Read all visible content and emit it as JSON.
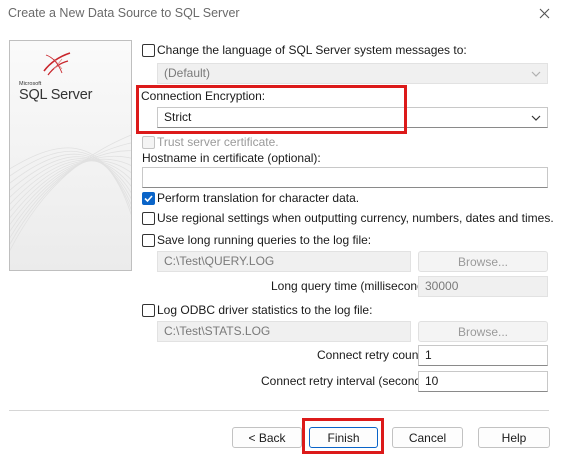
{
  "window": {
    "title": "Create a New Data Source to SQL Server"
  },
  "logo": {
    "small_text": "Microsoft",
    "product": "SQL Server"
  },
  "options": {
    "change_language": {
      "label": "Change the language of SQL Server system messages to:",
      "checked": false,
      "value": "(Default)"
    },
    "connection_encryption": {
      "label": "Connection Encryption:",
      "value": "Strict"
    },
    "trust_server_certificate": {
      "label": "Trust server certificate.",
      "checked": false,
      "disabled": true
    },
    "hostname_in_certificate": {
      "label": "Hostname in certificate (optional):",
      "value": ""
    },
    "perform_translation": {
      "label": "Perform translation for character data.",
      "checked": true
    },
    "regional_settings": {
      "label": "Use regional settings when outputting currency, numbers, dates and times.",
      "checked": false
    },
    "save_long_queries": {
      "label": "Save long running queries to the log file:",
      "checked": false,
      "path": "C:\\Test\\QUERY.LOG",
      "browse_label": "Browse...",
      "time_label": "Long query time (milliseconds):",
      "time_value": "30000"
    },
    "log_odbc_stats": {
      "label": "Log ODBC driver statistics to the log file:",
      "checked": false,
      "path": "C:\\Test\\STATS.LOG",
      "browse_label": "Browse..."
    },
    "retry_count": {
      "label": "Connect retry count:",
      "value": "1"
    },
    "retry_interval": {
      "label": "Connect retry interval (seconds):",
      "value": "10"
    }
  },
  "buttons": {
    "back": "< Back",
    "finish": "Finish",
    "cancel": "Cancel",
    "help": "Help"
  },
  "colors": {
    "highlight": "#dc1a1a",
    "accent": "#0a64c8"
  }
}
